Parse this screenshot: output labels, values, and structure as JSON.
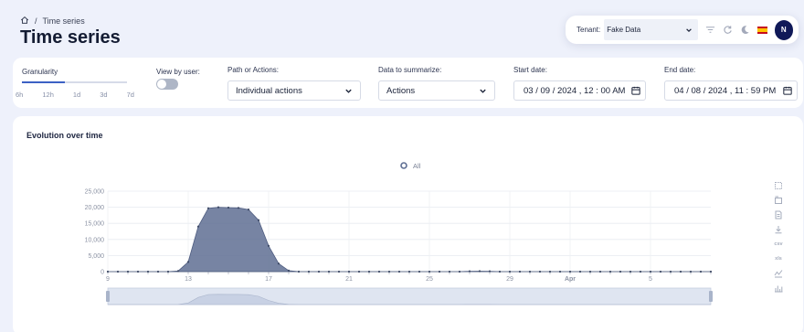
{
  "breadcrumb": {
    "separator": "/",
    "current": "Time series"
  },
  "page": {
    "title": "Time series"
  },
  "topbar": {
    "tenant_label": "Tenant:",
    "tenant_value": "Fake Data",
    "avatar_initial": "N"
  },
  "filters": {
    "granularity": {
      "label": "Granularity",
      "stops": [
        "6h",
        "12h",
        "1d",
        "3d",
        "7d"
      ],
      "selected": "12h"
    },
    "view_by_user": {
      "label": "View by user:",
      "enabled": false
    },
    "path_or_actions": {
      "label": "Path or Actions:",
      "value": "Individual actions"
    },
    "data_to_summarize": {
      "label": "Data to summarize:",
      "value": "Actions"
    },
    "start_date": {
      "label": "Start date:",
      "value": "03 / 09 / 2024 , 12 : 00  AM"
    },
    "end_date": {
      "label": "End date:",
      "value": "04 / 08 / 2024 , 11 : 59  PM"
    }
  },
  "chart_card": {
    "title": "Evolution over time"
  },
  "toolbox": {
    "csv_label": "csv",
    "xls_label": "xls"
  },
  "chart_data": {
    "type": "area",
    "title": "",
    "legend": {
      "entries": [
        "All"
      ],
      "position": "top-center"
    },
    "x_start": "2024-03-09",
    "x_end": "2024-04-08",
    "x_tick_labels": [
      "9",
      "13",
      "17",
      "21",
      "25",
      "29",
      "Apr",
      "5"
    ],
    "y_ticks": [
      0,
      5000,
      10000,
      15000,
      20000,
      25000
    ],
    "y_tick_labels": [
      "0",
      "5,000",
      "10,000",
      "15,000",
      "20,000",
      "25,000"
    ],
    "ylim": [
      0,
      25000
    ],
    "grid": true,
    "color": "#5f6f93",
    "series": [
      {
        "name": "All",
        "x": [
          "2024-03-09",
          "2024-03-09 12:00",
          "2024-03-10",
          "2024-03-10 12:00",
          "2024-03-11",
          "2024-03-11 12:00",
          "2024-03-12",
          "2024-03-12 12:00",
          "2024-03-13",
          "2024-03-13 12:00",
          "2024-03-14",
          "2024-03-14 12:00",
          "2024-03-15",
          "2024-03-15 12:00",
          "2024-03-16",
          "2024-03-16 12:00",
          "2024-03-17",
          "2024-03-17 12:00",
          "2024-03-18",
          "2024-03-18 12:00",
          "2024-03-19",
          "2024-03-19 12:00",
          "2024-03-20",
          "2024-03-20 12:00",
          "2024-03-21",
          "2024-03-21 12:00",
          "2024-03-22",
          "2024-03-22 12:00",
          "2024-03-23",
          "2024-03-23 12:00",
          "2024-03-24",
          "2024-03-24 12:00",
          "2024-03-25",
          "2024-03-25 12:00",
          "2024-03-26",
          "2024-03-26 12:00",
          "2024-03-27",
          "2024-03-27 12:00",
          "2024-03-28",
          "2024-03-28 12:00",
          "2024-03-29",
          "2024-03-29 12:00",
          "2024-03-30",
          "2024-03-30 12:00",
          "2024-03-31",
          "2024-03-31 12:00",
          "2024-04-01",
          "2024-04-01 12:00",
          "2024-04-02",
          "2024-04-02 12:00",
          "2024-04-03",
          "2024-04-03 12:00",
          "2024-04-04",
          "2024-04-04 12:00",
          "2024-04-05",
          "2024-04-05 12:00",
          "2024-04-06",
          "2024-04-06 12:00",
          "2024-04-07",
          "2024-04-07 12:00",
          "2024-04-08"
        ],
        "values": [
          0,
          0,
          0,
          0,
          0,
          0,
          0,
          200,
          3000,
          14000,
          19700,
          20000,
          19900,
          19800,
          19300,
          16000,
          8000,
          2500,
          300,
          0,
          0,
          0,
          0,
          0,
          0,
          0,
          0,
          0,
          0,
          0,
          0,
          0,
          0,
          0,
          0,
          0,
          100,
          150,
          100,
          0,
          0,
          0,
          0,
          0,
          0,
          0,
          0,
          0,
          0,
          0,
          0,
          0,
          0,
          0,
          0,
          0,
          0,
          0,
          0,
          0,
          0
        ]
      }
    ]
  }
}
